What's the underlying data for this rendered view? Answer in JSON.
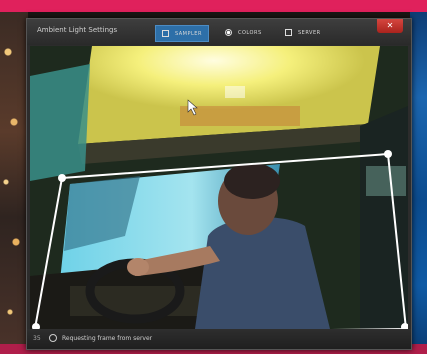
{
  "window": {
    "title": "Ambient Light Settings",
    "close_label": "✕",
    "tabs": [
      {
        "label": "SAMPLER",
        "icon": "sampler-icon",
        "active": true
      },
      {
        "label": "COLORS",
        "icon": "colors-icon",
        "active": false
      },
      {
        "label": "SERVER",
        "icon": "server-icon",
        "active": false
      }
    ]
  },
  "status": {
    "frame_number": "35",
    "message": "Requesting frame from server"
  },
  "colors": {
    "accent_tab": "#2d6fa8",
    "close_button": "#c4352e",
    "capture_outline": "#ffffff"
  }
}
